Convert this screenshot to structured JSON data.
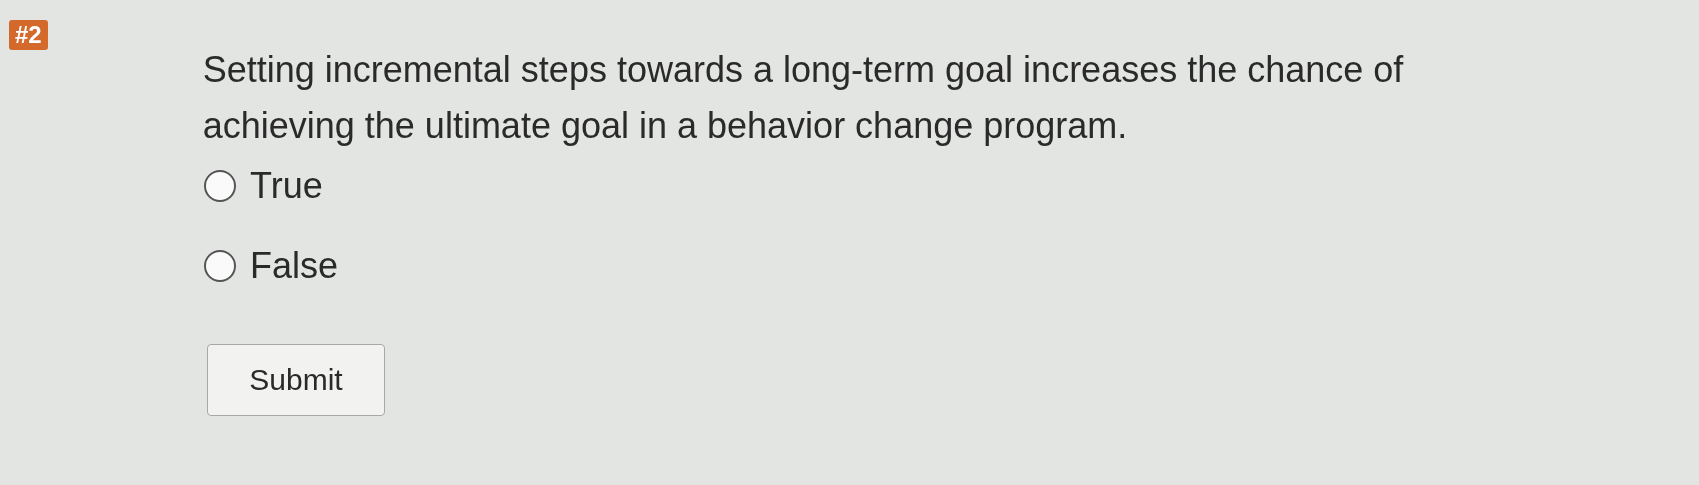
{
  "question": {
    "number": "#2",
    "text": "Setting incremental steps towards a long-term goal increases the chance of achieving the ultimate goal in a behavior change program."
  },
  "options": [
    {
      "label": "True",
      "selected": false
    },
    {
      "label": "False",
      "selected": false
    }
  ],
  "submit": {
    "label": "Submit"
  }
}
